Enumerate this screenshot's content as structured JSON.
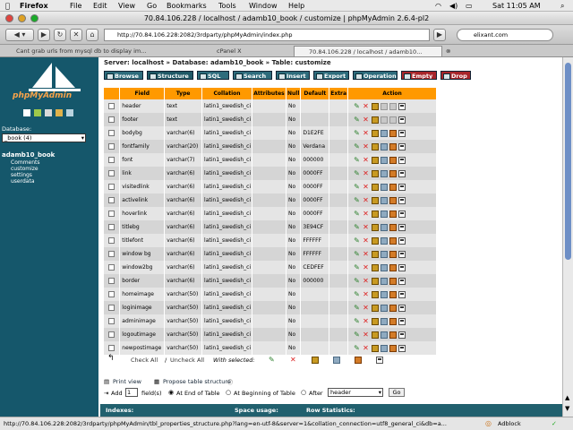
{
  "menu": {
    "apple": "",
    "app": "Firefox",
    "items": [
      "File",
      "Edit",
      "View",
      "Go",
      "Bookmarks",
      "Tools",
      "Window",
      "Help"
    ],
    "clock": "Sat 11:05 AM"
  },
  "window": {
    "title": "70.84.106.228 / localhost / adamb10_book / customize | phpMyAdmin 2.6.4-pl2"
  },
  "nav": {
    "url": "http://70.84.106.228:2082/3rdparty/phpMyAdmin/index.php",
    "search": "elixant.com"
  },
  "tabs": [
    {
      "label": "Cant grab urls from mysql db to display im..."
    },
    {
      "label": "cPanel X"
    },
    {
      "label": "70.84.106.228 / localhost / adamb10..."
    }
  ],
  "sidebar": {
    "logo": "phpMyAdmin",
    "db_label": "Database:",
    "db_select": "_book (4)",
    "db_name": "adamb10_book",
    "tables": [
      "Comments",
      "customize",
      "settings",
      "userdata"
    ]
  },
  "crumb": {
    "server_label": "Server:",
    "server": "localhost",
    "db_label": "Database:",
    "db": "adamb10_book",
    "table_label": "Table:",
    "table": "customize"
  },
  "toolbar": [
    "Browse",
    "Structure",
    "SQL",
    "Search",
    "Insert",
    "Export",
    "Operations",
    "Empty",
    "Drop"
  ],
  "columns": [
    "Field",
    "Type",
    "Collation",
    "Attributes",
    "Null",
    "Default",
    "Extra",
    "Action"
  ],
  "rows": [
    {
      "field": "header",
      "type": "text",
      "collation": "latin1_swedish_ci",
      "null": "No",
      "default": ""
    },
    {
      "field": "footer",
      "type": "text",
      "collation": "latin1_swedish_ci",
      "null": "No",
      "default": ""
    },
    {
      "field": "bodybg",
      "type": "varchar(6)",
      "collation": "latin1_swedish_ci",
      "null": "No",
      "default": "D1E2FE"
    },
    {
      "field": "fontfamily",
      "type": "varchar(20)",
      "collation": "latin1_swedish_ci",
      "null": "No",
      "default": "Verdana"
    },
    {
      "field": "font",
      "type": "varchar(7)",
      "collation": "latin1_swedish_ci",
      "null": "No",
      "default": "000000"
    },
    {
      "field": "link",
      "type": "varchar(6)",
      "collation": "latin1_swedish_ci",
      "null": "No",
      "default": "0000FF"
    },
    {
      "field": "visitedlink",
      "type": "varchar(6)",
      "collation": "latin1_swedish_ci",
      "null": "No",
      "default": "0000FF"
    },
    {
      "field": "activelink",
      "type": "varchar(6)",
      "collation": "latin1_swedish_ci",
      "null": "No",
      "default": "0000FF"
    },
    {
      "field": "hoverlink",
      "type": "varchar(6)",
      "collation": "latin1_swedish_ci",
      "null": "No",
      "default": "0000FF"
    },
    {
      "field": "titlebg",
      "type": "varchar(6)",
      "collation": "latin1_swedish_ci",
      "null": "No",
      "default": "3E94CF"
    },
    {
      "field": "titlefont",
      "type": "varchar(6)",
      "collation": "latin1_swedish_ci",
      "null": "No",
      "default": "FFFFFF"
    },
    {
      "field": "window bg",
      "type": "varchar(6)",
      "collation": "latin1_swedish_ci",
      "null": "No",
      "default": "FFFFFF"
    },
    {
      "field": "window2bg",
      "type": "varchar(6)",
      "collation": "latin1_swedish_ci",
      "null": "No",
      "default": "CEDFEF"
    },
    {
      "field": "border",
      "type": "varchar(6)",
      "collation": "latin1_swedish_ci",
      "null": "No",
      "default": "000000"
    },
    {
      "field": "homeimage",
      "type": "varchar(50)",
      "collation": "latin1_swedish_ci",
      "null": "No",
      "default": ""
    },
    {
      "field": "loginimage",
      "type": "varchar(50)",
      "collation": "latin1_swedish_ci",
      "null": "No",
      "default": ""
    },
    {
      "field": "adminimage",
      "type": "varchar(50)",
      "collation": "latin1_swedish_ci",
      "null": "No",
      "default": ""
    },
    {
      "field": "logoutimage",
      "type": "varchar(50)",
      "collation": "latin1_swedish_ci",
      "null": "No",
      "default": ""
    },
    {
      "field": "newpostimage",
      "type": "varchar(50)",
      "collation": "latin1_swedish_ci",
      "null": "No",
      "default": ""
    }
  ],
  "footer": {
    "check_all": "Check All",
    "sep": "/",
    "uncheck_all": "Uncheck All",
    "with_selected": "With selected:"
  },
  "bottom": {
    "print_view": "Print view",
    "propose": "Propose table structure",
    "add": "Add",
    "add_count": "1",
    "fields": "field(s)",
    "end": "At End of Table",
    "begin": "At Beginning of Table",
    "after": "After",
    "after_select": "header",
    "go": "Go"
  },
  "info": {
    "indexes": "Indexes:",
    "space": "Space usage:",
    "row_stats": "Row Statistics:"
  },
  "status": {
    "url": "http://70.84.106.228:2082/3rdparty/phpMyAdmin/tbl_properties_structure.php?lang=en-utf-8&server=1&collation_connection=utf8_general_ci&db=a...",
    "adblock": "Adblock"
  }
}
